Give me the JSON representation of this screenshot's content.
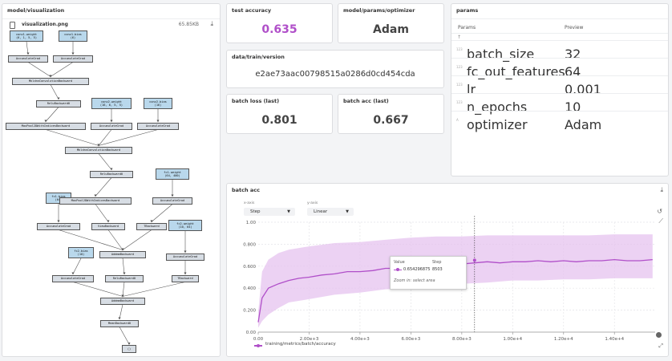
{
  "left_panel": {
    "title": "model/visualization",
    "file_name": "visualization.png",
    "file_size": "65.85KB"
  },
  "graph": {
    "nodes": [
      {
        "id": "n1",
        "label": "conv1.weight\n(6, 1, 5, 5)",
        "kind": "param"
      },
      {
        "id": "n2",
        "label": "conv1.bias\n(6)",
        "kind": "param"
      },
      {
        "id": "n3",
        "label": "AccumulateGrad",
        "kind": "op"
      },
      {
        "id": "n4",
        "label": "AccumulateGrad",
        "kind": "op"
      },
      {
        "id": "n5",
        "label": "MkldnnConvolutionBackward",
        "kind": "op"
      },
      {
        "id": "n6",
        "label": "ReluBackward0",
        "kind": "op"
      },
      {
        "id": "n7",
        "label": "conv2.weight\n(16, 6, 5, 5)",
        "kind": "param"
      },
      {
        "id": "n8",
        "label": "conv2.bias\n(16)",
        "kind": "param"
      },
      {
        "id": "n9",
        "label": "MaxPool2DWithIndicesBackward",
        "kind": "op"
      },
      {
        "id": "n10",
        "label": "AccumulateGrad",
        "kind": "op"
      },
      {
        "id": "n11",
        "label": "AccumulateGrad",
        "kind": "op"
      },
      {
        "id": "n12",
        "label": "MkldnnConvolutionBackward",
        "kind": "op"
      },
      {
        "id": "n13",
        "label": "ReluBackward0",
        "kind": "op"
      },
      {
        "id": "n14",
        "label": "fc1.weight\n(64, 400)",
        "kind": "param"
      },
      {
        "id": "n15",
        "label": "fc1.bias\n(64)",
        "kind": "param"
      },
      {
        "id": "n16",
        "label": "MaxPool2DWithIndicesBackward",
        "kind": "op"
      },
      {
        "id": "n17",
        "label": "AccumulateGrad",
        "kind": "op"
      },
      {
        "id": "n18",
        "label": "AccumulateGrad",
        "kind": "op"
      },
      {
        "id": "n19",
        "label": "ViewBackward",
        "kind": "op"
      },
      {
        "id": "n20",
        "label": "TBackward",
        "kind": "op"
      },
      {
        "id": "n21",
        "label": "fc2.weight\n(10, 64)",
        "kind": "param"
      },
      {
        "id": "n22",
        "label": "fc2.bias\n(10)",
        "kind": "param"
      },
      {
        "id": "n23",
        "label": "AddmmBackward",
        "kind": "op"
      },
      {
        "id": "n24",
        "label": "AccumulateGrad",
        "kind": "op"
      },
      {
        "id": "n25",
        "label": "AccumulateGrad",
        "kind": "op"
      },
      {
        "id": "n26",
        "label": "ReluBackward0",
        "kind": "op"
      },
      {
        "id": "n27",
        "label": "TBackward",
        "kind": "op"
      },
      {
        "id": "n28",
        "label": "AddmmBackward",
        "kind": "op"
      },
      {
        "id": "n29",
        "label": "MeanBackward0",
        "kind": "op"
      },
      {
        "id": "n30",
        "label": "()",
        "kind": "output"
      }
    ],
    "edges": [
      [
        "n1",
        "n3"
      ],
      [
        "n2",
        "n4"
      ],
      [
        "n3",
        "n5"
      ],
      [
        "n4",
        "n5"
      ],
      [
        "n5",
        "n6"
      ],
      [
        "n6",
        "n9"
      ],
      [
        "n7",
        "n10"
      ],
      [
        "n8",
        "n11"
      ],
      [
        "n9",
        "n12"
      ],
      [
        "n10",
        "n12"
      ],
      [
        "n11",
        "n12"
      ],
      [
        "n12",
        "n13"
      ],
      [
        "n13",
        "n16"
      ],
      [
        "n14",
        "n18"
      ],
      [
        "n15",
        "n17"
      ],
      [
        "n16",
        "n19"
      ],
      [
        "n18",
        "n20"
      ],
      [
        "n17",
        "n23"
      ],
      [
        "n19",
        "n23"
      ],
      [
        "n20",
        "n23"
      ],
      [
        "n21",
        "n25"
      ],
      [
        "n22",
        "n24"
      ],
      [
        "n23",
        "n26"
      ],
      [
        "n25",
        "n27"
      ],
      [
        "n24",
        "n28"
      ],
      [
        "n26",
        "n28"
      ],
      [
        "n27",
        "n28"
      ],
      [
        "n28",
        "n29"
      ],
      [
        "n29",
        "n30"
      ]
    ]
  },
  "summary": {
    "test_accuracy": {
      "title": "test accuracy",
      "value": "0.635"
    },
    "optimizer": {
      "title": "model/params/optimizer",
      "value": "Adam"
    },
    "data_version": {
      "title": "data/train/version",
      "value": "e2ae73aac00798515a0286d0cd454cda"
    },
    "batch_loss": {
      "title": "batch loss (last)",
      "value": "0.801"
    },
    "batch_acc": {
      "title": "batch acc (last)",
      "value": "0.667"
    }
  },
  "params": {
    "title": "params",
    "col_params": "Params",
    "col_preview": "Preview",
    "sort_icon": "↑",
    "rows": [
      {
        "name": "batch_size",
        "value": "32",
        "type": "number-icon"
      },
      {
        "name": "fc_out_features",
        "value": "64",
        "type": "number-icon"
      },
      {
        "name": "lr",
        "value": "0.001",
        "type": "number-icon"
      },
      {
        "name": "n_epochs",
        "value": "10",
        "type": "number-icon"
      },
      {
        "name": "optimizer",
        "value": "Adam",
        "type": "text-icon"
      }
    ]
  },
  "chart_panel": {
    "title": "batch acc",
    "xaxis_label": "x-axis",
    "xaxis_value": "Step",
    "yaxis_label": "y-axis",
    "yaxis_value": "Linear",
    "tooltip": {
      "value_header": "Value",
      "step_header": "Step",
      "value": "0.654296875",
      "step": "8503",
      "hint": "Zoom in: select area"
    }
  },
  "chart_data": {
    "type": "line",
    "title": "batch acc",
    "xlabel": "",
    "ylabel": "",
    "xlim": [
      0,
      15600
    ],
    "ylim": [
      0,
      1.0
    ],
    "x_ticks": [
      0,
      2000,
      4000,
      6000,
      8000,
      10000,
      12000,
      14000
    ],
    "x_tick_labels": [
      "0.00",
      "2.00e+3",
      "4.00e+3",
      "6.00e+3",
      "8.00e+3",
      "1.00e+4",
      "1.20e+4",
      "1.40e+4"
    ],
    "y_ticks": [
      0,
      0.2,
      0.4,
      0.6,
      0.8,
      1.0
    ],
    "y_tick_labels": [
      "0.00",
      "0.200",
      "0.400",
      "0.600",
      "0.800",
      "1.00"
    ],
    "grid": true,
    "legend": "bottom-left",
    "series": [
      {
        "name": "training/metrics/batch/accuracy",
        "color": "#b04fc9",
        "smoothed": {
          "x": [
            0,
            150,
            400,
            800,
            1200,
            1600,
            2000,
            2500,
            3000,
            3500,
            4000,
            4500,
            5000,
            5500,
            6000,
            6500,
            7000,
            7500,
            8000,
            8500,
            9000,
            9500,
            10000,
            10500,
            11000,
            11500,
            12000,
            12500,
            13000,
            13500,
            14000,
            14500,
            15000,
            15500
          ],
          "y": [
            0.09,
            0.31,
            0.4,
            0.44,
            0.47,
            0.49,
            0.5,
            0.52,
            0.53,
            0.55,
            0.55,
            0.56,
            0.58,
            0.58,
            0.6,
            0.59,
            0.6,
            0.61,
            0.62,
            0.63,
            0.64,
            0.63,
            0.64,
            0.64,
            0.65,
            0.64,
            0.65,
            0.64,
            0.65,
            0.65,
            0.66,
            0.65,
            0.65,
            0.66
          ]
        },
        "raw_band": {
          "x": [
            0,
            150,
            400,
            800,
            1200,
            2000,
            3000,
            4000,
            5000,
            6000,
            7000,
            8000,
            9000,
            10000,
            11000,
            12000,
            13000,
            14000,
            15500
          ],
          "low": [
            0.04,
            0.1,
            0.16,
            0.22,
            0.27,
            0.3,
            0.34,
            0.36,
            0.39,
            0.4,
            0.42,
            0.44,
            0.45,
            0.47,
            0.47,
            0.48,
            0.48,
            0.49,
            0.49
          ],
          "high": [
            0.18,
            0.55,
            0.66,
            0.72,
            0.75,
            0.78,
            0.81,
            0.82,
            0.84,
            0.86,
            0.87,
            0.87,
            0.88,
            0.88,
            0.88,
            0.88,
            0.88,
            0.89,
            0.89
          ]
        }
      }
    ],
    "cursor_x": 8503,
    "highlight": {
      "x": 8503,
      "y": 0.654296875
    }
  }
}
